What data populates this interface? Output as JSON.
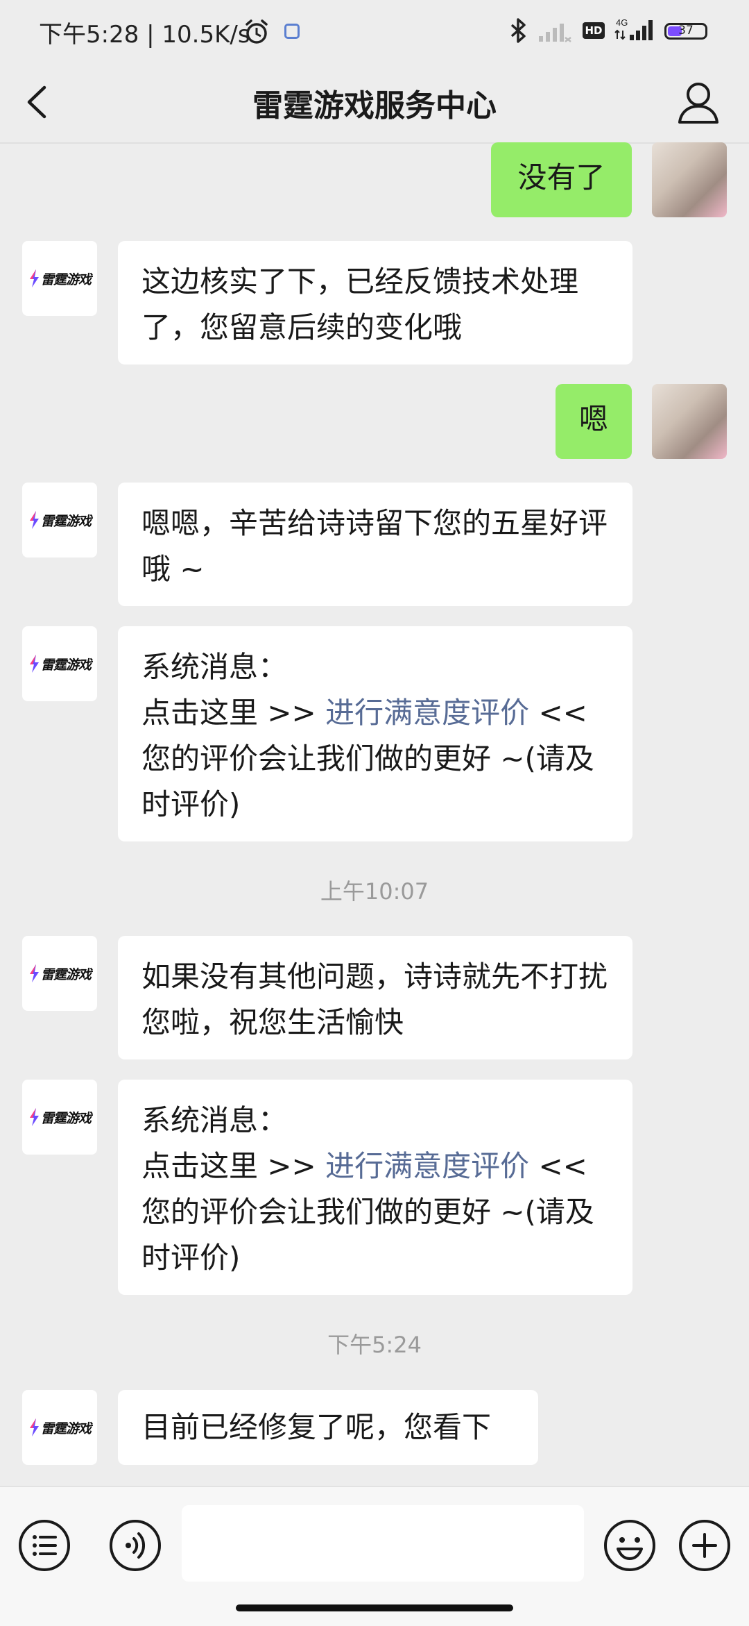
{
  "status_bar": {
    "time_speed": "下午5:28 | 10.5K/s",
    "network": "4G",
    "hd": "HD",
    "battery": "37"
  },
  "header": {
    "title": "雷霆游戏服务中心"
  },
  "bot": {
    "logo_text": "雷霆游戏"
  },
  "messages": {
    "m1": {
      "text": "没有了"
    },
    "m2": {
      "text": "这边核实了下，已经反馈技术处理了，您留意后续的变化哦"
    },
    "m3": {
      "text": "嗯"
    },
    "m4": {
      "text": "嗯嗯，辛苦给诗诗留下您的五星好评哦 ~"
    },
    "m5": {
      "line1": "系统消息：",
      "before": "点击这里 >> ",
      "link": "进行满意度评价",
      "after": " << 您的评价会让我们做的更好 ~(请及时评价)"
    },
    "t1": "上午10:07",
    "m6": {
      "text": "如果没有其他问题，诗诗就先不打扰您啦，祝您生活愉快"
    },
    "m7": {
      "line1": "系统消息：",
      "before": "点击这里 >> ",
      "link": "进行满意度评价",
      "after": " << 您的评价会让我们做的更好 ~(请及时评价)"
    },
    "t2": "下午5:24",
    "m8": {
      "text": "目前已经修复了呢，您看下"
    }
  },
  "input": {
    "value": ""
  },
  "colors": {
    "self_bubble": "#95ec69",
    "other_bubble": "#ffffff",
    "link": "#576b95",
    "background": "#ededed"
  }
}
